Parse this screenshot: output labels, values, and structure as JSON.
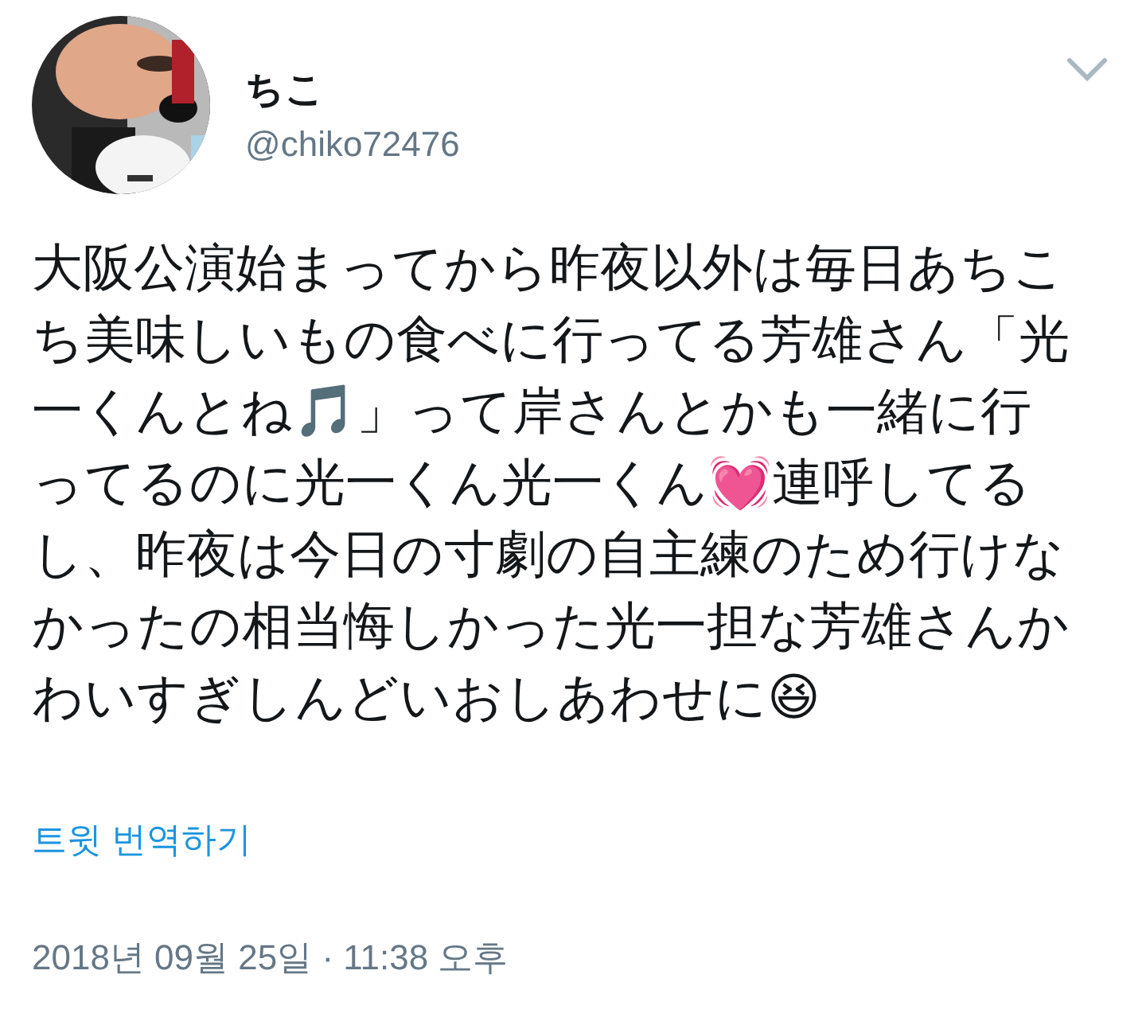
{
  "tweet": {
    "author": {
      "name": "ちこ",
      "handle": "@chiko72476"
    },
    "text": "大阪公演始まってから昨夜以外は毎日あちこち美味しいもの食べに行ってる芳雄さん「光一くんとね🎵」って岸さんとかも一緒に行ってるのに光一くん光一くん💓連呼してるし、昨夜は今日の寸劇の自主練のため行けなかったの相当悔しかった光一担な芳雄さんかわいすぎしんどいおしあわせに😆",
    "translate_link": "트윗 번역하기",
    "timestamp": "2018년 09월 25일 · 11:38 오후"
  }
}
